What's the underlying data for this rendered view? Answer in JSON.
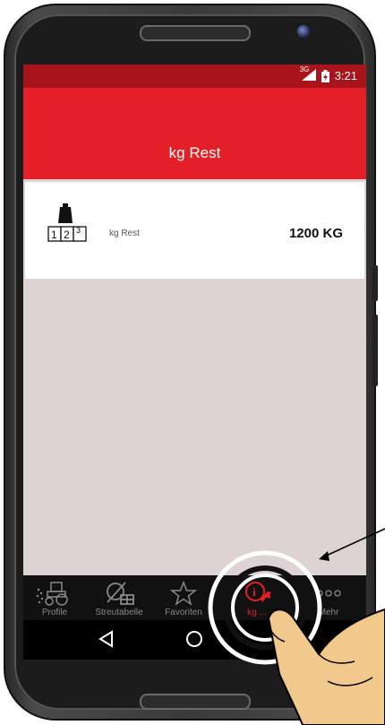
{
  "status": {
    "network": "3G",
    "time": "3:21"
  },
  "appbar": {
    "title": "kg Rest"
  },
  "card": {
    "label": "kg Rest",
    "value": "1200 KG",
    "icon_digits": [
      "1",
      "2",
      "3"
    ]
  },
  "nav": {
    "items": [
      {
        "label": "Profile",
        "icon": "tractor-icon"
      },
      {
        "label": "Streutabelle",
        "icon": "spreader-table-icon"
      },
      {
        "label": "Favoriten",
        "icon": "star-icon"
      },
      {
        "label": "kg ...",
        "icon": "info-wrench-icon",
        "active": true
      },
      {
        "label": "Mehr",
        "icon": "more-icon"
      }
    ]
  },
  "colors": {
    "accent": "#e32027",
    "status_bar": "#a8141b",
    "background": "#ddd3d3"
  }
}
